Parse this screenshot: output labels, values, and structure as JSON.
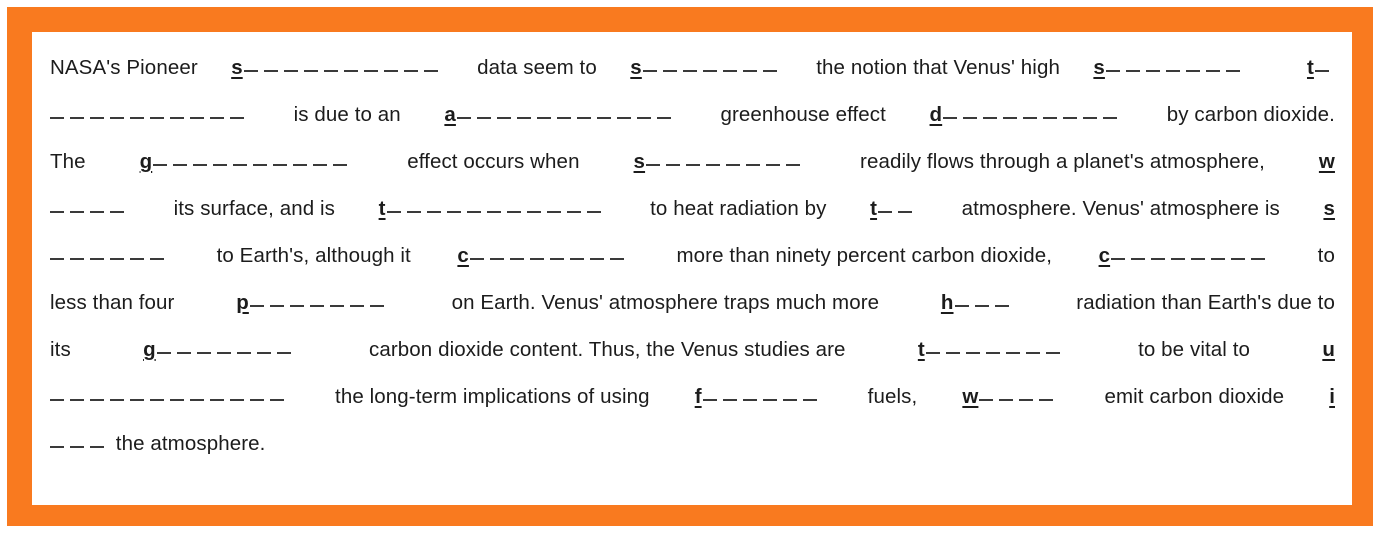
{
  "document": {
    "type": "cloze-worksheet",
    "title": "Venus Greenhouse Effect Cloze Passage",
    "border_color": "#f97a1f",
    "paper_color": "#ffffff",
    "text_color": "#1c1c1c"
  },
  "passage": {
    "full_text": "NASA's Pioneer s__________ data seem to s_______ the notion that Venus' high s_______ t___________ is due to an a___________ greenhouse effect d_________ by carbon dioxide. The g__________ effect occurs when s________ readily flows through a planet's atmosphere, w_____ its surface, and is t___________ to heat radiation by t___ atmosphere. Venus' atmosphere is s_______ to Earth's, although it c________ more than ninety percent carbon dioxide, c_________ to less than four p_______ on Earth. Venus' atmosphere traps much more h____ radiation than Earth's due to its g_______ carbon dioxide content. Thus, the Venus studies are t________ to be vital to u____________ the long-term implications of using f______ fuels, w_____ emit carbon dioxide i____ the atmosphere.",
    "lines": [
      {
        "align": "justify",
        "segments": [
          {
            "kind": "text",
            "value": "NASA's Pioneer "
          },
          {
            "kind": "cloze",
            "starter": "s",
            "dashes": 10
          },
          {
            "kind": "text",
            "value": " data seem to "
          },
          {
            "kind": "cloze",
            "starter": "s",
            "dashes": 7
          },
          {
            "kind": "text",
            "value": " the notion that Venus' high "
          },
          {
            "kind": "cloze",
            "starter": "s",
            "dashes": 7
          },
          {
            "kind": "text",
            "value": " "
          },
          {
            "kind": "cloze",
            "starter": "t",
            "dashes": 1
          }
        ]
      },
      {
        "align": "justify",
        "segments": [
          {
            "kind": "blank",
            "dashes": 10
          },
          {
            "kind": "text",
            "value": " is due to an "
          },
          {
            "kind": "cloze",
            "starter": "a",
            "dashes": 11
          },
          {
            "kind": "text",
            "value": " greenhouse effect "
          },
          {
            "kind": "cloze",
            "starter": "d",
            "dashes": 9
          },
          {
            "kind": "text",
            "value": " by carbon dioxide."
          }
        ]
      },
      {
        "align": "justify",
        "segments": [
          {
            "kind": "text",
            "value": "The "
          },
          {
            "kind": "cloze",
            "starter": "g",
            "dashes": 10
          },
          {
            "kind": "text",
            "value": " effect occurs when "
          },
          {
            "kind": "cloze",
            "starter": "s",
            "dashes": 8
          },
          {
            "kind": "text",
            "value": " readily flows through a planet's atmosphere, "
          },
          {
            "kind": "cloze",
            "starter": "w",
            "dashes": 0
          }
        ]
      },
      {
        "align": "justify",
        "segments": [
          {
            "kind": "blank",
            "dashes": 4
          },
          {
            "kind": "text",
            "value": " its surface, and is "
          },
          {
            "kind": "cloze",
            "starter": "t",
            "dashes": 11
          },
          {
            "kind": "text",
            "value": " to heat radiation by "
          },
          {
            "kind": "cloze",
            "starter": "t",
            "dashes": 2
          },
          {
            "kind": "text",
            "value": " atmosphere. Venus' atmosphere is "
          },
          {
            "kind": "cloze",
            "starter": "s",
            "dashes": 0
          }
        ]
      },
      {
        "align": "justify",
        "segments": [
          {
            "kind": "blank",
            "dashes": 6
          },
          {
            "kind": "text",
            "value": " to Earth's, although it "
          },
          {
            "kind": "cloze",
            "starter": "c",
            "dashes": 8
          },
          {
            "kind": "text",
            "value": " more than ninety percent carbon dioxide, "
          },
          {
            "kind": "cloze",
            "starter": "c",
            "dashes": 8
          },
          {
            "kind": "text",
            "value": " to"
          }
        ]
      },
      {
        "align": "justify",
        "segments": [
          {
            "kind": "text",
            "value": "less than four "
          },
          {
            "kind": "cloze",
            "starter": "p",
            "dashes": 7
          },
          {
            "kind": "text",
            "value": " on Earth. Venus' atmosphere traps much more "
          },
          {
            "kind": "cloze",
            "starter": "h",
            "dashes": 3
          },
          {
            "kind": "text",
            "value": " radiation than Earth's due to"
          }
        ]
      },
      {
        "align": "justify",
        "segments": [
          {
            "kind": "text",
            "value": "its "
          },
          {
            "kind": "cloze",
            "starter": "g",
            "dashes": 7
          },
          {
            "kind": "text",
            "value": " carbon dioxide content. Thus, the Venus studies are "
          },
          {
            "kind": "cloze",
            "starter": "t",
            "dashes": 7
          },
          {
            "kind": "text",
            "value": " to be vital to "
          },
          {
            "kind": "cloze",
            "starter": "u",
            "dashes": 0
          }
        ]
      },
      {
        "align": "justify",
        "segments": [
          {
            "kind": "blank",
            "dashes": 12
          },
          {
            "kind": "text",
            "value": " the long-term implications of using "
          },
          {
            "kind": "cloze",
            "starter": "f",
            "dashes": 6
          },
          {
            "kind": "text",
            "value": " fuels, "
          },
          {
            "kind": "cloze",
            "starter": "w",
            "dashes": 4
          },
          {
            "kind": "text",
            "value": " emit carbon dioxide "
          },
          {
            "kind": "cloze",
            "starter": "i",
            "dashes": 0
          }
        ]
      },
      {
        "align": "left",
        "segments": [
          {
            "kind": "blank",
            "dashes": 3
          },
          {
            "kind": "text",
            "value": " the atmosphere."
          }
        ]
      }
    ]
  }
}
